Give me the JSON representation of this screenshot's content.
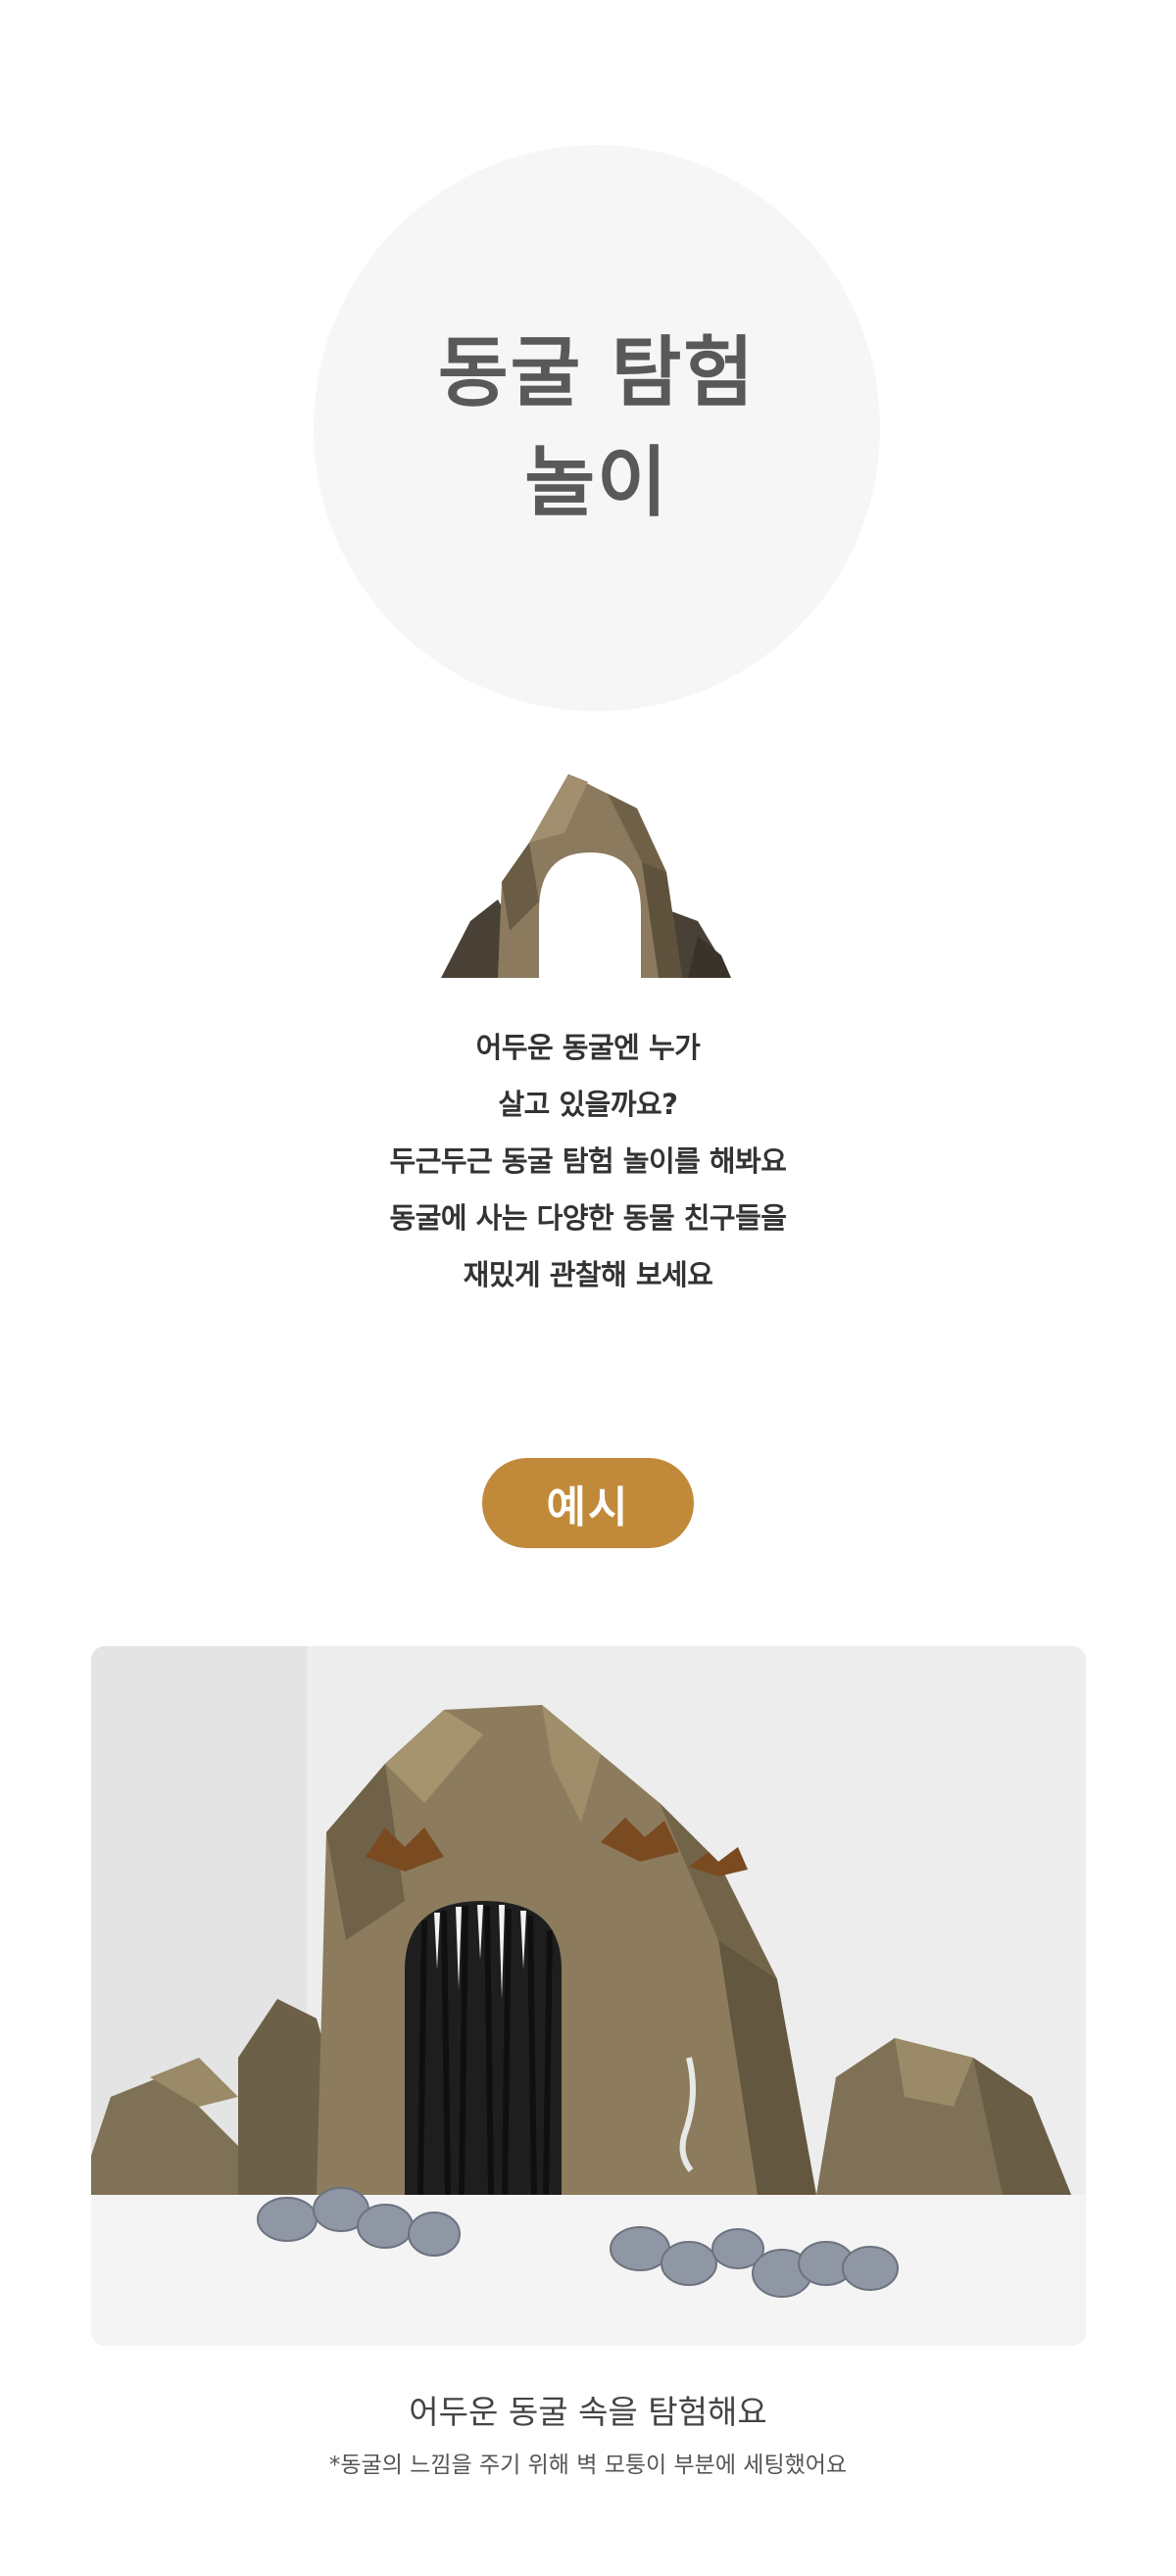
{
  "hero": {
    "title_line1": "동굴 탐험",
    "title_line2": "놀이"
  },
  "icons": {
    "cave_icon": "cave-arch-icon"
  },
  "intro": {
    "lines": [
      "어두운 동굴엔 누가",
      "살고 있을까요?",
      "두근두근 동굴 탐험 놀이를 해봐요",
      "동굴에 사는 다양한 동물 친구들을",
      "재밌게 관찰해 보세요"
    ]
  },
  "badge": {
    "label": "예시"
  },
  "example": {
    "caption": "어두운 동굴 속을 탐험해요",
    "note": "*동굴의 느낌을 주기 위해 벽 모퉁이 부분에 세팅했어요"
  },
  "colors": {
    "badge": "#c18a3a",
    "circle": "#f6f6f6",
    "title": "#595959",
    "rock": "#8a7a5e"
  }
}
